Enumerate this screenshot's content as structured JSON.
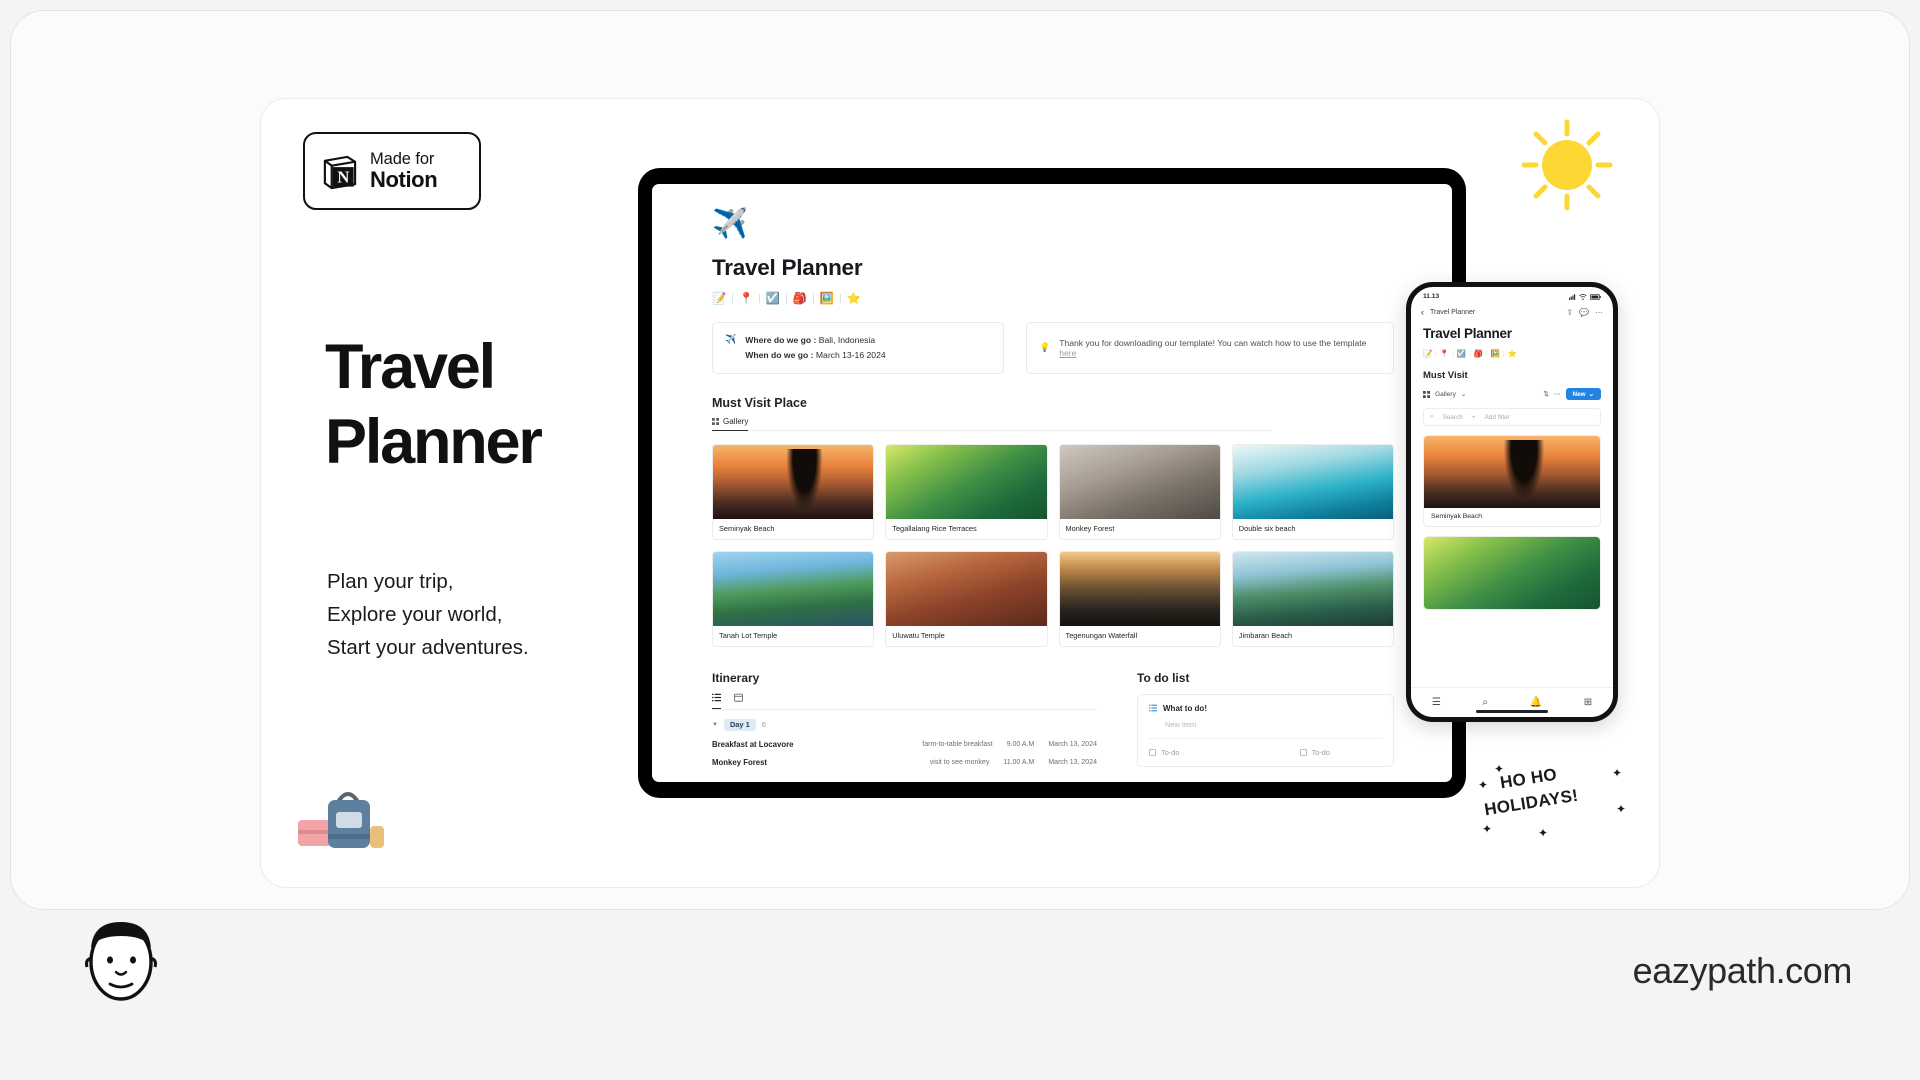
{
  "brand": {
    "badge_made": "Made for",
    "badge_word": "Notion",
    "site_url": "eazypath.com"
  },
  "hero": {
    "title_line1": "Travel",
    "title_line2": "Planner",
    "tagline_line1": "Plan your trip,",
    "tagline_line2": "Explore your world,",
    "tagline_line3": "Start your adventures."
  },
  "stamp": {
    "line1": "HO HO",
    "line2": "HOLIDAYS!"
  },
  "tablet": {
    "hero_emoji": "✈️",
    "page_title": "Travel Planner",
    "emoji_nav": [
      "📝",
      "📍",
      "☑️",
      "🎒",
      "🖼️",
      "⭐"
    ],
    "callout_left": {
      "icon": "✈️",
      "label1": "Where do we go :",
      "value1": "Bali, Indonesia",
      "label2": "When do we go  :",
      "value2": "March 13-16 2024"
    },
    "callout_right": {
      "icon": "💡",
      "text": "Thank you for downloading our template! You can watch how to use the template ",
      "link": "here"
    },
    "gallery_section": {
      "heading": "Must Visit Place",
      "view_tab": "Gallery",
      "cards": [
        {
          "caption": "Seminyak Beach",
          "img": "img-sunset-palm"
        },
        {
          "caption": "Tegallalang Rice Terraces",
          "img": "img-rice"
        },
        {
          "caption": "Monkey Forest",
          "img": "img-monkey"
        },
        {
          "caption": "Double six beach",
          "img": "img-wave"
        },
        {
          "caption": "Tanah Lot Temple",
          "img": "img-tanahlot"
        },
        {
          "caption": "Uluwatu Temple",
          "img": "img-uluwatu"
        },
        {
          "caption": "Tegenungan Waterfall",
          "img": "img-waterfall"
        },
        {
          "caption": "Jimbaran Beach",
          "img": "img-jimbaran"
        }
      ]
    },
    "itinerary": {
      "heading": "Itinerary",
      "group_label": "Day 1",
      "group_count": "6",
      "rows": [
        {
          "name": "Breakfast at Locavore",
          "note": "farm-to-table breakfast",
          "time": "9.00 A.M",
          "date": "March 13, 2024"
        },
        {
          "name": "Monkey Forest",
          "note": "visit to see monkey",
          "time": "11.00 A.M",
          "date": "March 13, 2024"
        }
      ]
    },
    "todo": {
      "heading": "To do list",
      "list_title": "What to do!",
      "new_item": "New Item",
      "check_left": "To-do",
      "check_right": "To-do"
    }
  },
  "phone": {
    "status_time": "11.13",
    "nav_back_label": "Travel Planner",
    "page_title": "Travel Planner",
    "emoji_nav": [
      "📝",
      "📍",
      "☑️",
      "🎒",
      "🖼️",
      "⭐"
    ],
    "section_heading": "Must Visit",
    "view_tab": "Gallery",
    "new_button": "New",
    "search_placeholder": "Search",
    "add_filter": "Add filter",
    "cards": [
      {
        "caption": "Seminyak Beach",
        "img": "img-sunset-palm"
      },
      {
        "caption": "",
        "img": "img-rice"
      }
    ]
  },
  "colors": {
    "accent_blue": "#2383e2",
    "chip_blue": "#dfeaf4",
    "canvas": "#f4f4f4"
  }
}
